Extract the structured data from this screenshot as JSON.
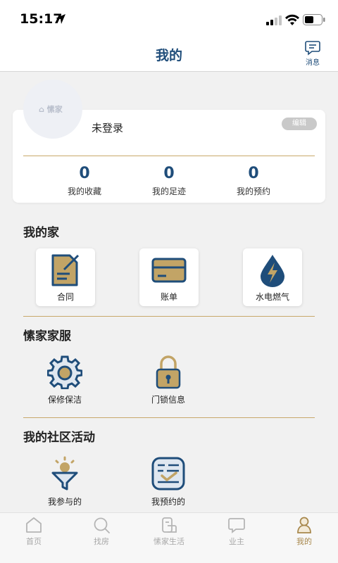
{
  "status": {
    "time": "15:17"
  },
  "header": {
    "title": "我的",
    "message_label": "消息"
  },
  "profile": {
    "logo_text": "愫家",
    "login_status": "未登录",
    "edit_label": "编辑",
    "stats": [
      {
        "value": "0",
        "label": "我的收藏"
      },
      {
        "value": "0",
        "label": "我的足迹"
      },
      {
        "value": "0",
        "label": "我的预约"
      }
    ]
  },
  "my_home": {
    "title": "我的家",
    "items": [
      {
        "label": "合同",
        "icon": "contract-icon"
      },
      {
        "label": "账单",
        "icon": "bill-card-icon"
      },
      {
        "label": "水电燃气",
        "icon": "utilities-drop-icon"
      }
    ]
  },
  "services": {
    "title": "愫家家服",
    "items": [
      {
        "label": "保修保洁",
        "icon": "gear-icon"
      },
      {
        "label": "门锁信息",
        "icon": "lock-icon"
      }
    ]
  },
  "community": {
    "title": "我的社区活动",
    "items": [
      {
        "label": "我参与的",
        "icon": "participate-icon"
      },
      {
        "label": "我预约的",
        "icon": "reservation-icon"
      }
    ]
  },
  "tabbar": {
    "items": [
      {
        "label": "首页",
        "icon": "home-icon",
        "active": false
      },
      {
        "label": "找房",
        "icon": "search-icon",
        "active": false
      },
      {
        "label": "愫家生活",
        "icon": "life-icon",
        "active": false
      },
      {
        "label": "业主",
        "icon": "chat-icon",
        "active": false
      },
      {
        "label": "我的",
        "icon": "person-icon",
        "active": true
      }
    ]
  },
  "colors": {
    "navy": "#1f4d7a",
    "gold": "#c8a86a",
    "tile_gold": "#c2a466",
    "active_tab": "#a8884c"
  }
}
